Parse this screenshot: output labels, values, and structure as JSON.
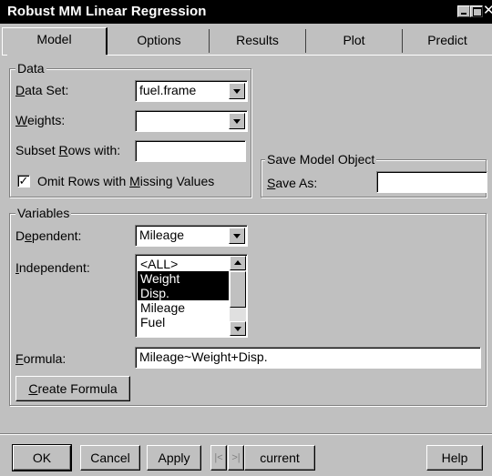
{
  "window": {
    "title": "Robust MM Linear Regression",
    "close_glyph": "✕"
  },
  "tabs": [
    {
      "label": "Model"
    },
    {
      "label": "Options"
    },
    {
      "label": "Results"
    },
    {
      "label": "Plot"
    },
    {
      "label": "Predict"
    }
  ],
  "data_group": {
    "legend": "Data",
    "data_set": {
      "label_u": "D",
      "label_rest": "ata Set:",
      "value": "fuel.frame"
    },
    "weights": {
      "label_u": "W",
      "label_rest": "eights:",
      "value": ""
    },
    "subset": {
      "label_pre": "Subset ",
      "label_u": "R",
      "label_rest": "ows with:",
      "value": ""
    },
    "omit": {
      "checked_glyph": "✓",
      "label_pre": "Omit Rows with ",
      "label_u": "M",
      "label_rest": "issing Values",
      "checked": true
    }
  },
  "save_group": {
    "legend": "Save Model Object",
    "save_as": {
      "label_pre": "",
      "label_u": "S",
      "label_rest": "ave As:",
      "value": ""
    }
  },
  "variables_group": {
    "legend": "Variables",
    "dependent": {
      "label_pre": "D",
      "label_u": "e",
      "label_rest": "pendent:",
      "value": "Mileage"
    },
    "independent": {
      "label_u": "I",
      "label_rest": "ndependent:",
      "items": [
        "<ALL>",
        "Weight",
        "Disp.",
        "Mileage",
        "Fuel"
      ],
      "selected": [
        "Weight",
        "Disp."
      ]
    },
    "formula": {
      "label_u": "F",
      "label_rest": "ormula:",
      "value": "Mileage~Weight+Disp."
    },
    "create_formula": {
      "label_u": "C",
      "label_rest": "reate Formula"
    }
  },
  "footer": {
    "ok": "OK",
    "cancel": "Cancel",
    "apply": "Apply",
    "prev_glyph": "|<",
    "next_glyph": ">|",
    "current": "current",
    "help": "Help"
  }
}
